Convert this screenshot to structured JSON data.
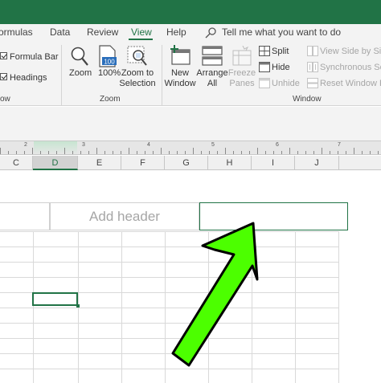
{
  "tabs": [
    {
      "label": "ormulas",
      "active": false
    },
    {
      "label": "Data",
      "active": false
    },
    {
      "label": "Review",
      "active": false
    },
    {
      "label": "View",
      "active": true
    },
    {
      "label": "Help",
      "active": false
    }
  ],
  "tell_me": {
    "placeholder": "Tell me what you want to do",
    "icon": "lightbulb-icon"
  },
  "show_group": {
    "formula_bar": {
      "label": "Formula Bar",
      "checked": true
    },
    "headings": {
      "label": "Headings",
      "checked": true
    },
    "partial_label": "ow"
  },
  "zoom_group": {
    "label": "Zoom",
    "zoom_button": {
      "label": "Zoom",
      "icon": "magnifier-icon"
    },
    "hundred_button": {
      "label": "100%",
      "icon": "100-percent-icon",
      "badge": "100"
    },
    "zoom_selection_button": {
      "label_line1": "Zoom to",
      "label_line2": "Selection",
      "icon": "zoom-selection-icon"
    }
  },
  "window_group": {
    "label": "Window",
    "new_window": {
      "label_line1": "New",
      "label_line2": "Window",
      "icon": "new-window-icon"
    },
    "arrange_all": {
      "label_line1": "Arrange",
      "label_line2": "All",
      "icon": "arrange-all-icon"
    },
    "freeze_panes": {
      "label_line1": "Freeze",
      "label_line2": "Panes",
      "enabled": false,
      "icon": "freeze-panes-icon"
    },
    "split": {
      "label": "Split",
      "icon": "split-icon"
    },
    "hide": {
      "label": "Hide",
      "icon": "hide-icon"
    },
    "unhide": {
      "label": "Unhide",
      "enabled": false,
      "icon": "unhide-icon"
    },
    "view_side_by_side": {
      "label": "View Side by Side",
      "enabled": false,
      "icon": "side-by-side-icon"
    },
    "synchronous_scrolling": {
      "label": "Synchronous Scro",
      "enabled": false,
      "icon": "sync-scroll-icon"
    },
    "reset_window_position": {
      "label": "Reset Window Po",
      "enabled": false,
      "icon": "reset-position-icon"
    }
  },
  "ruler": {
    "numbers": [
      "2",
      "3",
      "4",
      "5",
      "6",
      "7"
    ]
  },
  "columns": [
    {
      "label": "C",
      "selected": false
    },
    {
      "label": "D",
      "selected": true
    },
    {
      "label": "E",
      "selected": false
    },
    {
      "label": "F",
      "selected": false
    },
    {
      "label": "G",
      "selected": false
    },
    {
      "label": "H",
      "selected": false
    },
    {
      "label": "I",
      "selected": false
    },
    {
      "label": "J",
      "selected": false
    }
  ],
  "header": {
    "center_placeholder": "Add header"
  },
  "colors": {
    "accent": "#217346",
    "arrow_fill": "#4cff00",
    "arrow_outline": "#000000"
  }
}
